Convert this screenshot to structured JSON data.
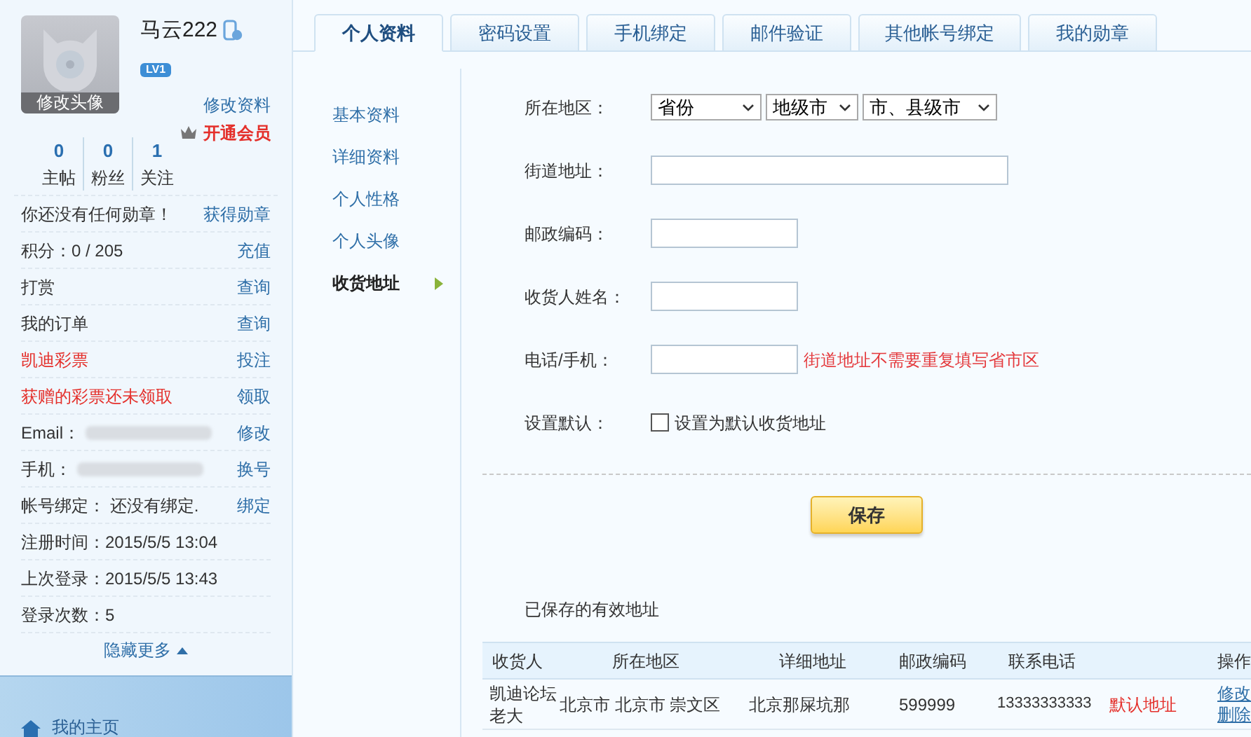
{
  "user": {
    "name": "马云222",
    "level": "LV1",
    "avatar_caption": "修改头像",
    "edit_profile": "修改资料",
    "vip": "开通会员"
  },
  "stats": [
    {
      "value": "0",
      "label": "主帖"
    },
    {
      "value": "0",
      "label": "粉丝"
    },
    {
      "value": "1",
      "label": "关注"
    }
  ],
  "info_rows": [
    {
      "kind": "plain",
      "text": "你还没有任何勋章！",
      "action": "获得勋章"
    },
    {
      "kind": "plain",
      "text": "积分：0 / 205",
      "action": "充值"
    },
    {
      "kind": "plain",
      "text": "打赏",
      "action": "查询"
    },
    {
      "kind": "plain",
      "text": "我的订单",
      "action": "查询"
    },
    {
      "kind": "alert",
      "text": "凯迪彩票",
      "action": "投注"
    },
    {
      "kind": "alert",
      "text": "获赠的彩票还未领取",
      "action": "领取"
    },
    {
      "kind": "redacted",
      "text": "Email：",
      "action": "修改"
    },
    {
      "kind": "redacted",
      "text": "手机：",
      "action": "换号"
    },
    {
      "kind": "plain",
      "text": "帐号绑定： 还没有绑定.",
      "action": "绑定"
    },
    {
      "kind": "plain",
      "text": "注册时间：2015/5/5 13:04"
    },
    {
      "kind": "plain",
      "text": "上次登录：2015/5/5 13:43"
    },
    {
      "kind": "plain",
      "text": "登录次数：5"
    }
  ],
  "more": "隐藏更多",
  "nav_home": "我的主页",
  "tabs": [
    {
      "label": "个人资料",
      "selected": true
    },
    {
      "label": "密码设置",
      "selected": false
    },
    {
      "label": "手机绑定",
      "selected": false
    },
    {
      "label": "邮件验证",
      "selected": false
    },
    {
      "label": "其他帐号绑定",
      "selected": false
    },
    {
      "label": "我的勋章",
      "selected": false
    }
  ],
  "subnav": [
    {
      "label": "基本资料",
      "selected": false
    },
    {
      "label": "详细资料",
      "selected": false
    },
    {
      "label": "个人性格",
      "selected": false
    },
    {
      "label": "个人头像",
      "selected": false
    },
    {
      "label": "收货地址",
      "selected": true
    }
  ],
  "form": {
    "fields": [
      {
        "kind": "selects",
        "label": "所在地区：",
        "options": [
          "省份",
          "地级市",
          "市、县级市"
        ]
      },
      {
        "kind": "wide",
        "label": "街道地址："
      },
      {
        "kind": "short",
        "label": "邮政编码："
      },
      {
        "kind": "short",
        "label": "收货人姓名："
      },
      {
        "kind": "short",
        "label": "电话/手机：",
        "hint": "街道地址不需要重复填写省市区"
      },
      {
        "kind": "checkbox",
        "label": "设置默认：",
        "checked": false,
        "text": "设置为默认收货地址"
      }
    ],
    "save": "保存"
  },
  "saved": {
    "title": "已保存的有效地址",
    "columns": [
      "收货人",
      "所在地区",
      "详细地址",
      "邮政编码",
      "联系电话",
      "操作"
    ],
    "rows": [
      {
        "cells": [
          "凯迪论坛老大",
          "北京市 北京市 崇文区",
          "北京那屎坑那",
          "599999",
          "13333333333"
        ],
        "status": "默认地址",
        "actions": [
          "修改",
          "删除"
        ]
      }
    ]
  }
}
